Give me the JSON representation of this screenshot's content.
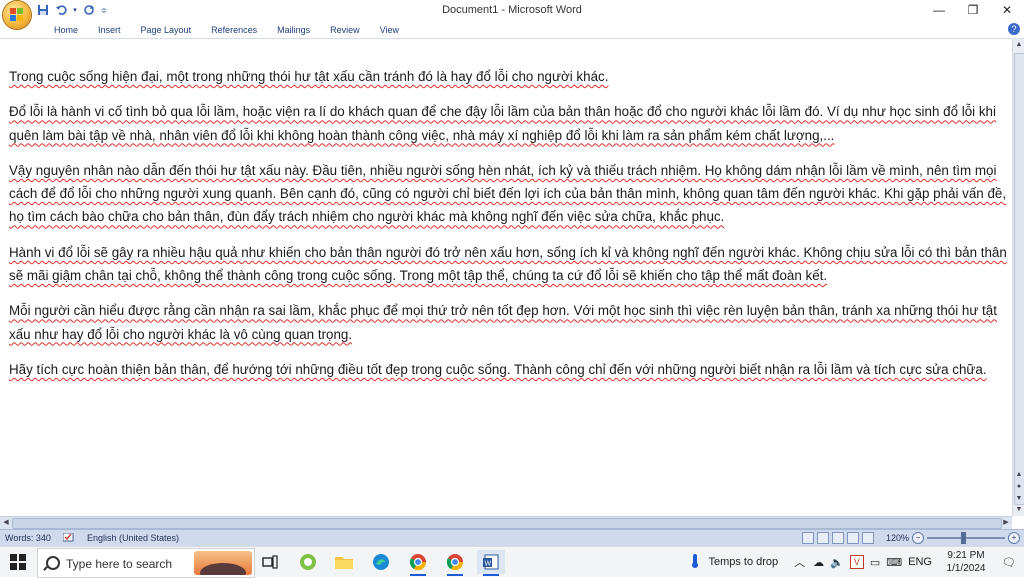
{
  "window": {
    "title": "Document1 - Microsoft Word",
    "controls": [
      "minimize",
      "restore",
      "close"
    ]
  },
  "ribbon": {
    "tabs": [
      "Home",
      "Insert",
      "Page Layout",
      "References",
      "Mailings",
      "Review",
      "View"
    ]
  },
  "document": {
    "paragraphs": [
      "Trong cuộc sống hiện đại, một trong những thói hư tật xấu cần tránh đó là hay đổ lỗi cho người khác.",
      "Đổ lỗi là hành vi cố tình bỏ qua lỗi lầm, hoặc viện ra lí do khách quan để che đậy lỗi lầm của bản thân hoặc đổ cho người khác lỗi lầm đó. Ví dụ như học sinh đổ lỗi khi quên làm bài tập về nhà, nhân viên đổ lỗi khi không hoàn thành công việc, nhà máy xí nghiệp đổ lỗi khi làm ra sản phẩm kém chất lượng,...",
      "Vậy nguyên nhân nào dẫn đến thói hư tật xấu này. Đầu tiên, nhiều người sống hèn nhát, ích kỷ và thiếu trách nhiệm. Họ không dám nhận lỗi lầm về mình, nên tìm mọi cách để đổ lỗi cho những người xung quanh. Bên cạnh đó, cũng có người chỉ biết đến lợi ích của bản thân mình, không quan tâm đến người khác. Khi gặp phải vấn đề, họ tìm cách bào chữa cho bản thân, đùn đẩy trách nhiệm cho người khác mà không nghĩ đến việc sửa chữa, khắc phục.",
      "Hành vi đổ lỗi sẽ gây ra nhiều hậu quả như khiến cho bản thân người đó trở nên xấu hơn, sống ích kỉ và không nghĩ đến người khác. Không chịu sửa lỗi có thì bản thân sẽ mãi giậm chân tại chỗ, không thể thành công trong cuộc sống. Trong một tập thể, chúng ta cứ đổ lỗi sẽ khiến cho tập thể mất đoàn kết.",
      "Mỗi người cần hiểu được rằng cần nhận ra sai lầm, khắc phục để mọi thứ trở nên tốt đẹp hơn. Với một học sinh thì việc rèn luyện bản thân, tránh xa những thói hư tật xấu như hay đổ lỗi cho người khác là vô cùng quan trọng.",
      "Hãy tích cực hoàn thiện bản thân, để hướng tới những điều tốt đẹp trong cuộc sống. Thành công chỉ đến với những người biết nhận ra lỗi lầm và tích cực sửa chữa."
    ]
  },
  "statusbar": {
    "words": "Words: 340",
    "language": "English (United States)",
    "zoom": "120%"
  },
  "taskbar": {
    "search_placeholder": "Type here to search",
    "weather": "Temps to drop",
    "language": "ENG",
    "time": "9:21 PM",
    "date": "1/1/2024",
    "apps": [
      "task-view",
      "wechat",
      "file-explorer",
      "edge",
      "chrome",
      "chrome-alt",
      "word"
    ]
  },
  "colors": {
    "accent": "#1e5bd6",
    "spellcheck": "#e0312b",
    "statusbar": "#cfdaec"
  }
}
